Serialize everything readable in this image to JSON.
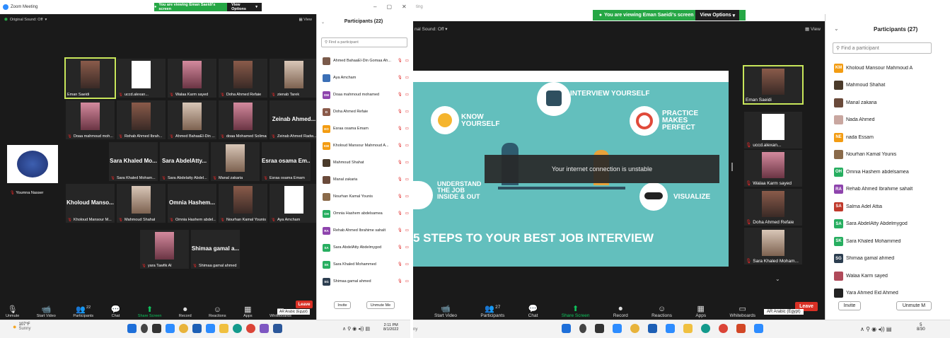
{
  "left": {
    "window_title": "Zoom Meeting",
    "banner": "You are viewing Eman Saeidi's screen",
    "view_options": "View Options",
    "original_sound": "Original Sound: Off",
    "view": "View",
    "win_controls": [
      "–",
      "▢",
      "✕"
    ],
    "tiles": [
      {
        "name": "Eman Saeidi",
        "type": "photo",
        "active": true
      },
      {
        "name": "uccd.alexan...",
        "type": "doc"
      },
      {
        "name": "Walaa Karm sayed",
        "type": "photo"
      },
      {
        "name": "Doha Ahmed Refaie",
        "type": "photo"
      },
      {
        "name": "zienab Tarek",
        "type": "photo"
      },
      {
        "name": "Doaa mahmoud moh...",
        "type": "photo"
      },
      {
        "name": "Rehab Ahmed Ibrah...",
        "type": "photo"
      },
      {
        "name": "Ahmed BahaaEl-Din ...",
        "type": "photo"
      },
      {
        "name": "doaa Mohamed Soliman",
        "type": "photo"
      },
      {
        "name": "Zeinab Ahmed Radw...",
        "big": "Zeinab Ahmed..."
      },
      {
        "name": "Youmna Nasser",
        "type": "logo"
      },
      {
        "name": "Sara Khaled Moham...",
        "big": "Sara Khaled Mo..."
      },
      {
        "name": "Sara Abdelatty Abdel...",
        "big": "Sara AbdelAtty..."
      },
      {
        "name": "Manal zakaria",
        "type": "photo"
      },
      {
        "name": "Esraa osama Emam",
        "big": "Esraa osama Em..."
      },
      {
        "name": "Kholoud Mansour M...",
        "big": "Kholoud Manso..."
      },
      {
        "name": "Mahmoud Shahat",
        "type": "photo"
      },
      {
        "name": "Omnia Hashem abdel...",
        "big": "Omnia Hashem..."
      },
      {
        "name": "Nourhan Kamal Younis",
        "type": "photo"
      },
      {
        "name": "Aya Amcham",
        "type": "doc"
      },
      {
        "name": "yara Tawfik Al",
        "type": "photo"
      },
      {
        "name": "Shimaa gamal ahmed",
        "big": "Shimaa gamal a..."
      }
    ],
    "toolbar": [
      {
        "label": "Unmute",
        "icon": "🎙"
      },
      {
        "label": "Start Video",
        "icon": "📹"
      },
      {
        "label": "Participants",
        "icon": "👥",
        "count": "22"
      },
      {
        "label": "Chat",
        "icon": "💬"
      },
      {
        "label": "Share Screen",
        "icon": "⬆"
      },
      {
        "label": "Record",
        "icon": "⏺"
      },
      {
        "label": "Reactions",
        "icon": "☺"
      },
      {
        "label": "Apps",
        "icon": "▦"
      },
      {
        "label": "Whiteboards",
        "icon": "▭"
      }
    ],
    "leave": "Leave",
    "language": "AR Arabic (Egypt)",
    "weather_temp": "107°F",
    "weather_desc": "Sunny",
    "clock_time": "2:11 PM",
    "clock_date": "8/1/2022",
    "participants_title": "Participants (22)",
    "search_placeholder": "Find a participant",
    "participants": [
      {
        "name": "Ahmed BahaaEl-Din Gomaa Ah...",
        "initials": "",
        "color": "#7a5a4a"
      },
      {
        "name": "Aya Amcham",
        "initials": "",
        "color": "#3b6fb6"
      },
      {
        "name": "Doaa mahmoud mohamed",
        "initials": "DM",
        "color": "#8e44ad"
      },
      {
        "name": "Doha Ahmed Refaie",
        "initials": "D",
        "color": "#8a5a4a"
      },
      {
        "name": "Esraa osama Emam",
        "initials": "EO",
        "color": "#f39c12"
      },
      {
        "name": "Kholoud Mansour Mahmoud A...",
        "initials": "KM",
        "color": "#f39c12"
      },
      {
        "name": "Mahmoud Shahat",
        "initials": "",
        "color": "#4a3a2a"
      },
      {
        "name": "Manal zakaria",
        "initials": "",
        "color": "#6a4a3a"
      },
      {
        "name": "Nourhan Kamal Younis",
        "initials": "",
        "color": "#8a6a4a"
      },
      {
        "name": "Omnia Hashem abdelsamea",
        "initials": "OH",
        "color": "#27ae60"
      },
      {
        "name": "Rehab Ahmed Ibrahime sahalt",
        "initials": "RA",
        "color": "#8e44ad"
      },
      {
        "name": "Sara AbdelAtty Abdelmygod",
        "initials": "SA",
        "color": "#27ae60"
      },
      {
        "name": "Sara Khaled Mohammed",
        "initials": "SK",
        "color": "#27ae60"
      },
      {
        "name": "Shimaa gamal ahmed",
        "initials": "SG",
        "color": "#2c3e50"
      }
    ],
    "invite": "Invite",
    "unmute_me": "Unmute Me"
  },
  "right": {
    "window_title": "ting",
    "banner": "You are viewing Eman Saeidi's screen",
    "view_options": "View Options",
    "original_sound": "nal Sound: Off",
    "view": "View",
    "slide": {
      "know": "KNOW YOURSELF",
      "interview": "INTERVIEW YOURSELF",
      "practice": "PRACTICE MAKES PERFECT",
      "understand": "UNDERSTAND THE JOB INSIDE & OUT",
      "visualize": "VISUALIZE",
      "footer": "5 STEPS TO YOUR BEST JOB INTERVIEW"
    },
    "unstable": "Your internet connection is unstable",
    "tiles": [
      {
        "name": "Eman Saeidi",
        "type": "photo",
        "active": true
      },
      {
        "name": "uccd.alexan...",
        "type": "doc"
      },
      {
        "name": "Walaa Karm sayed",
        "type": "photo"
      },
      {
        "name": "Doha Ahmed Refaie",
        "type": "photo"
      },
      {
        "name": "Sara Khaled Moham...",
        "type": "photo"
      }
    ],
    "toolbar": [
      {
        "label": "Start Video",
        "icon": "📹"
      },
      {
        "label": "Participants",
        "icon": "👥",
        "count": "27"
      },
      {
        "label": "Chat",
        "icon": "💬"
      },
      {
        "label": "Share Screen",
        "icon": "⬆"
      },
      {
        "label": "Record",
        "icon": "⏺"
      },
      {
        "label": "Reactions",
        "icon": "☺"
      },
      {
        "label": "Apps",
        "icon": "▦"
      },
      {
        "label": "Whiteboards",
        "icon": "▭"
      }
    ],
    "leave": "Leave",
    "language": "AR Arabic (Egypt)",
    "weather_desc": "ny",
    "clock_time": "5",
    "clock_date": "8/30",
    "participants_title": "Participants (27)",
    "search_placeholder": "Find a participant",
    "participants": [
      {
        "name": "Kholoud Mansour Mahmoud A",
        "initials": "KM",
        "color": "#f39c12"
      },
      {
        "name": "Mahmoud Shahat",
        "initials": "",
        "color": "#4a3a2a"
      },
      {
        "name": "Manal zakaria",
        "initials": "",
        "color": "#6a4a3a"
      },
      {
        "name": "Nada Ahmed",
        "initials": "",
        "color": "#c9a7a0"
      },
      {
        "name": "nada Essam",
        "initials": "NE",
        "color": "#f39c12"
      },
      {
        "name": "Nourhan Kamal Younis",
        "initials": "",
        "color": "#8a6a4a"
      },
      {
        "name": "Omnia Hashem abdelsamea",
        "initials": "OH",
        "color": "#27ae60"
      },
      {
        "name": "Rehab Ahmed Ibrahime sahalt",
        "initials": "RA",
        "color": "#8e44ad"
      },
      {
        "name": "Salma Adel Attia",
        "initials": "SA",
        "color": "#c0392b"
      },
      {
        "name": "Sara AbdelAtty Abdelmygod",
        "initials": "SA",
        "color": "#27ae60"
      },
      {
        "name": "Sara Khaled Mohammed",
        "initials": "SK",
        "color": "#27ae60"
      },
      {
        "name": "Shimaa gamal ahmed",
        "initials": "SG",
        "color": "#2c3e50"
      },
      {
        "name": "Walaa Karm sayed",
        "initials": "",
        "color": "#b04a5a"
      },
      {
        "name": "Yara Ahmed Eid Ahmed",
        "initials": "",
        "color": "#222222"
      }
    ],
    "invite": "Invite",
    "unmute_me": "Unmute M"
  },
  "colors": {
    "banner_green": "#26a745",
    "leave_red": "#d93025",
    "slide_teal": "#63bfbd",
    "mic_red": "#e02828"
  }
}
